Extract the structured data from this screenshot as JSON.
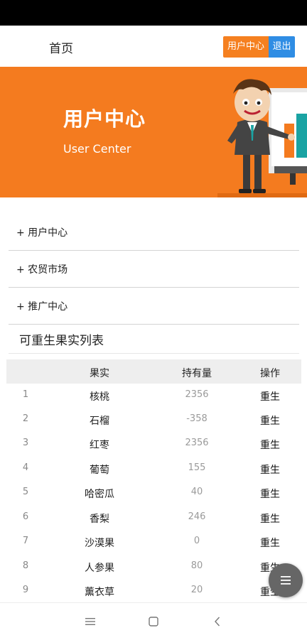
{
  "nav": {
    "home_label": "首页",
    "user_center_button": "用户中心",
    "logout_button": "退出"
  },
  "banner": {
    "title": "用户中心",
    "subtitle": "User Center"
  },
  "menu": {
    "items": [
      {
        "label": "+ 用户中心"
      },
      {
        "label": "+ 农贸市场"
      },
      {
        "label": "+ 推广中心"
      }
    ]
  },
  "list": {
    "title": "可重生果实列表",
    "headers": {
      "index": "",
      "fruit": "果实",
      "quantity": "持有量",
      "action": "操作"
    },
    "rows": [
      {
        "index": "1",
        "fruit": "核桃",
        "quantity": "2356",
        "action": "重生"
      },
      {
        "index": "2",
        "fruit": "石榴",
        "quantity": "-358",
        "action": "重生"
      },
      {
        "index": "3",
        "fruit": "红枣",
        "quantity": "2356",
        "action": "重生"
      },
      {
        "index": "4",
        "fruit": "葡萄",
        "quantity": "155",
        "action": "重生"
      },
      {
        "index": "5",
        "fruit": "哈密瓜",
        "quantity": "40",
        "action": "重生"
      },
      {
        "index": "6",
        "fruit": "香梨",
        "quantity": "246",
        "action": "重生"
      },
      {
        "index": "7",
        "fruit": "沙漠果",
        "quantity": "0",
        "action": "重生"
      },
      {
        "index": "8",
        "fruit": "人参果",
        "quantity": "80",
        "action": "重生"
      },
      {
        "index": "9",
        "fruit": "薰衣草",
        "quantity": "20",
        "action": "重生"
      }
    ]
  },
  "colors": {
    "accent_orange": "#f47b1f",
    "accent_blue": "#2f8de4"
  },
  "icons": {
    "fab": "menu-icon",
    "system_nav": [
      "menu-icon",
      "home-square-icon",
      "back-chevron-icon"
    ]
  }
}
